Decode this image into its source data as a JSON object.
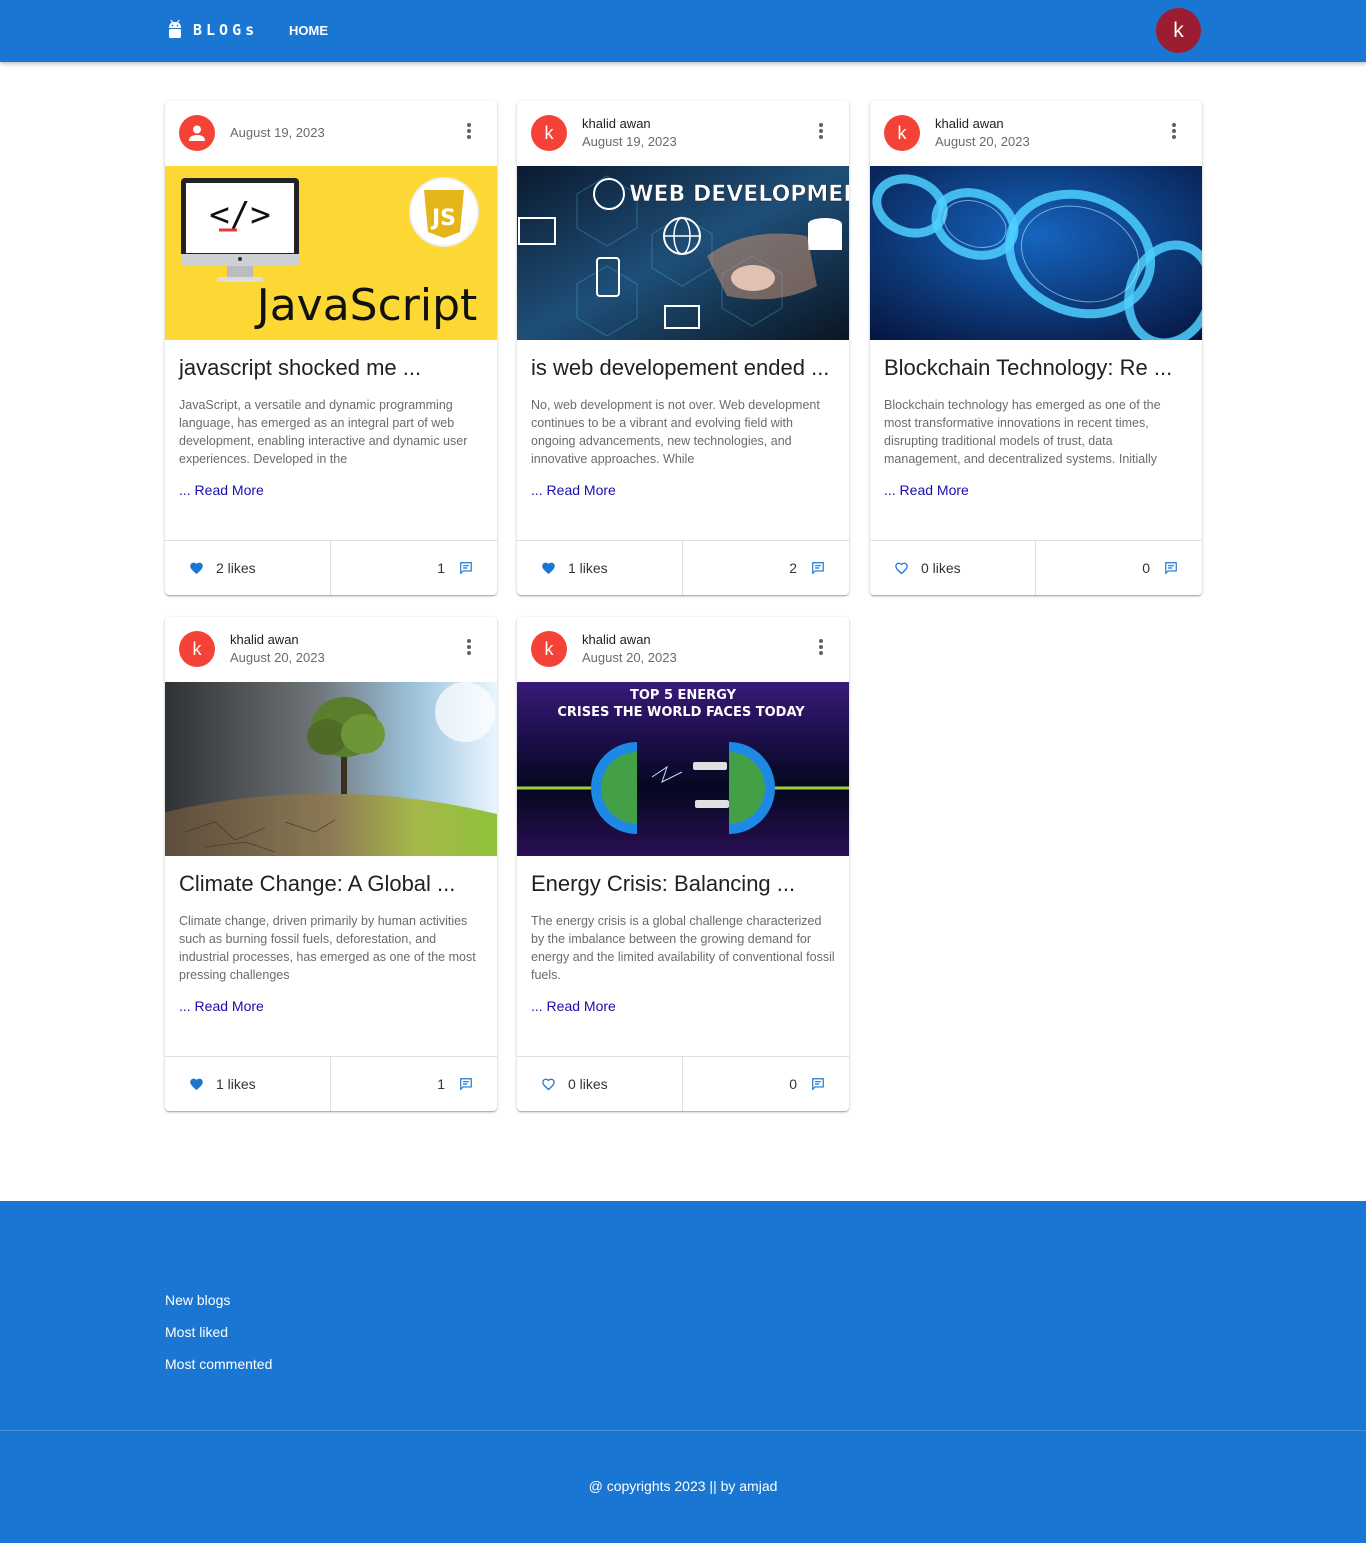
{
  "header": {
    "brand": "BLOGs",
    "nav_home": "HOME",
    "user_initial": "k"
  },
  "posts": [
    {
      "avatar": "person-icon",
      "author": "",
      "date": "August 19, 2023",
      "title": "javascript shocked me ...",
      "excerpt": "JavaScript, a versatile and dynamic programming language, has emerged as an integral part of web development, enabling interactive and dynamic user experiences. Developed in the",
      "read_more": "... Read More",
      "likes": "2 likes",
      "liked": true,
      "comments": "1",
      "image_desc": "javascript-thumbnail",
      "image_text": "JavaScript"
    },
    {
      "avatar": "k",
      "author": "khalid awan",
      "date": "August 19, 2023",
      "title": "is web developement ended ...",
      "excerpt": "No, web development is not over. Web development continues to be a vibrant and evolving field with ongoing advancements, new technologies, and innovative approaches. While",
      "read_more": "... Read More",
      "likes": "1 likes",
      "liked": true,
      "comments": "2",
      "image_desc": "web-development-thumbnail",
      "image_text": "WEB DEVELOPMENT"
    },
    {
      "avatar": "k",
      "author": "khalid awan",
      "date": "August 20, 2023",
      "title": "Blockchain Technology: Re ...",
      "excerpt": "Blockchain technology has emerged as one of the most transformative innovations in recent times, disrupting traditional models of trust, data management, and decentralized systems. Initially",
      "read_more": "... Read More",
      "likes": "0 likes",
      "liked": false,
      "comments": "0",
      "image_desc": "blockchain-thumbnail"
    },
    {
      "avatar": "k",
      "author": "khalid awan",
      "date": "August 20, 2023",
      "title": "Climate Change: A Global ...",
      "excerpt": "Climate change, driven primarily by human activities such as burning fossil fuels, deforestation, and industrial processes, has emerged as one of the most pressing challenges",
      "read_more": "... Read More",
      "likes": "1 likes",
      "liked": true,
      "comments": "1",
      "image_desc": "climate-thumbnail"
    },
    {
      "avatar": "k",
      "author": "khalid awan",
      "date": "August 20, 2023",
      "title": "Energy Crisis: Balancing ...",
      "excerpt": "The energy crisis is a global challenge characterized by the imbalance between the growing demand for energy and the limited availability of conventional fossil fuels.",
      "read_more": "... Read More",
      "likes": "0 likes",
      "liked": false,
      "comments": "0",
      "image_desc": "energy-thumbnail",
      "image_text_1": "TOP 5 ENERGY",
      "image_text_2": "CRISES THE WORLD FACES TODAY"
    }
  ],
  "footer": {
    "links": [
      "New blogs",
      "Most liked",
      "Most commented"
    ],
    "copyright": "@ copyrights 2023 || by amjad"
  },
  "colors": {
    "primary": "#1976d2",
    "user_avatar": "#9c1d31",
    "card_avatar": "#f44336",
    "read_more": "#1a0dab"
  }
}
